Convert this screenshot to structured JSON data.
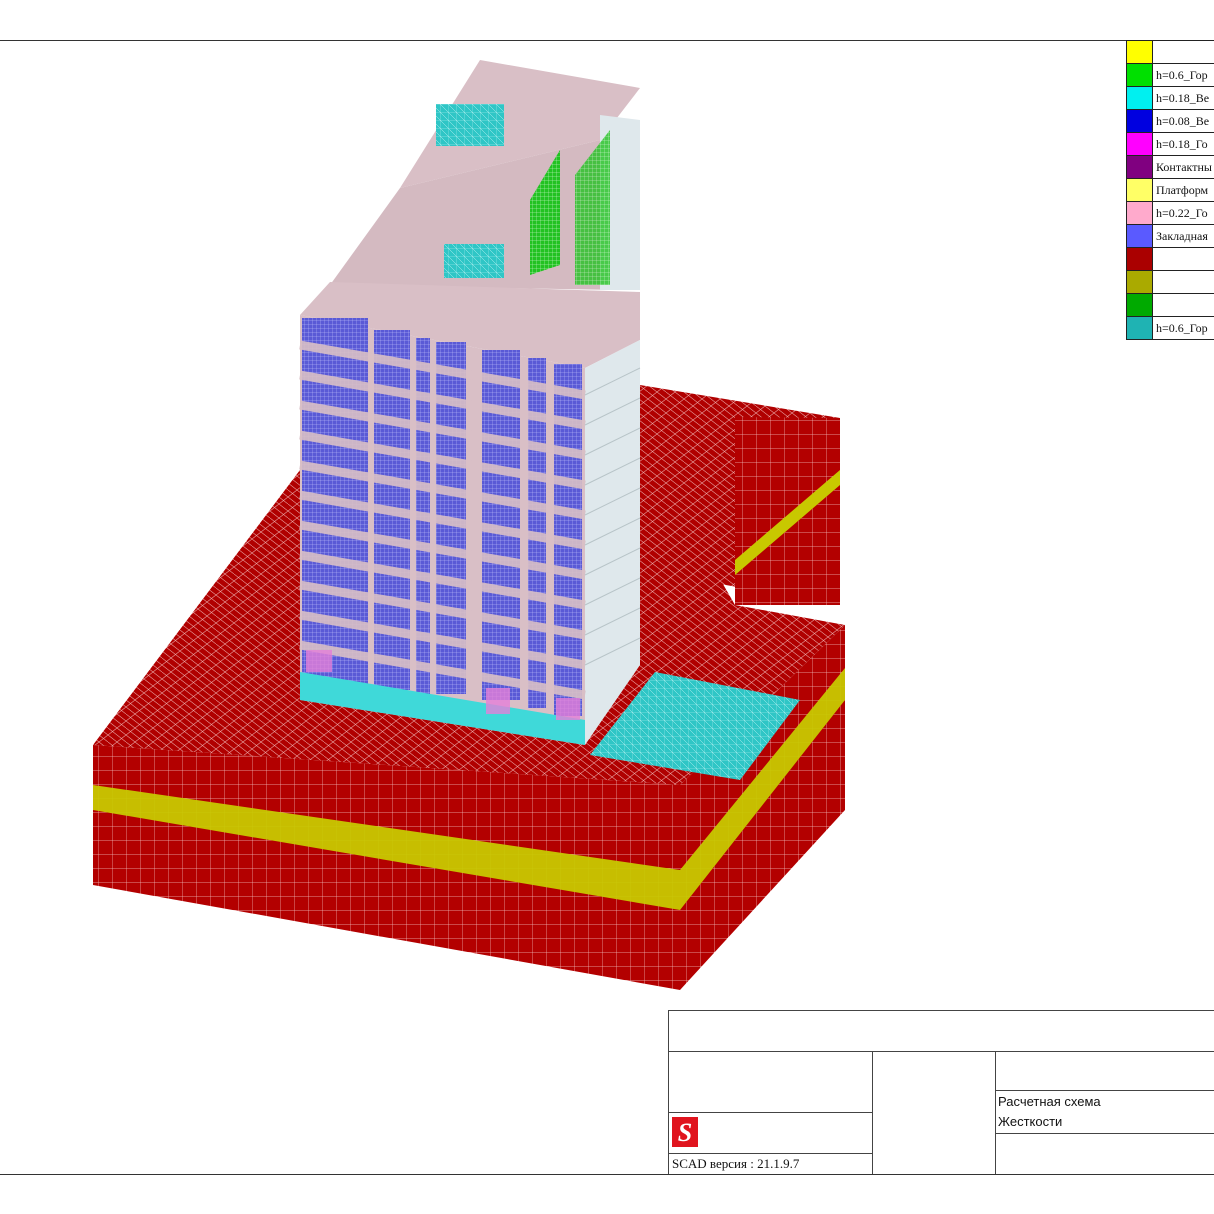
{
  "legend": {
    "items": [
      {
        "color": "#ffff00",
        "label": ""
      },
      {
        "color": "#00e000",
        "label": "h=0.6_Гор"
      },
      {
        "color": "#00f0f0",
        "label": "h=0.18_Ве"
      },
      {
        "color": "#0000e0",
        "label": "h=0.08_Ве"
      },
      {
        "color": "#ff00ff",
        "label": "h=0.18_Го"
      },
      {
        "color": "#800080",
        "label": "Контактны"
      },
      {
        "color": "#ffff66",
        "label": "Платформ"
      },
      {
        "color": "#ffaacc",
        "label": "h=0.22_Го"
      },
      {
        "color": "#5a5aff",
        "label": "Закладная"
      },
      {
        "color": "#aa0000",
        "label": ""
      },
      {
        "color": "#aaaa00",
        "label": ""
      },
      {
        "color": "#00aa00",
        "label": ""
      },
      {
        "color": "#1fb3b3",
        "label": "h=0.6_Гор"
      }
    ]
  },
  "title_block": {
    "line1": "Расчетная схема",
    "line2": "Жесткости",
    "version": "SCAD версия : 21.1.9.7",
    "logo_letter": "S"
  },
  "colors": {
    "soil": "#b30000",
    "soil_layer": "#c8c800",
    "slab": "#d9bfc6",
    "wall_side": "#dfe8ec",
    "panel": "#6a6ad8",
    "cyan": "#3fd9d9",
    "green": "#22c222",
    "pink": "#e37fd8"
  }
}
